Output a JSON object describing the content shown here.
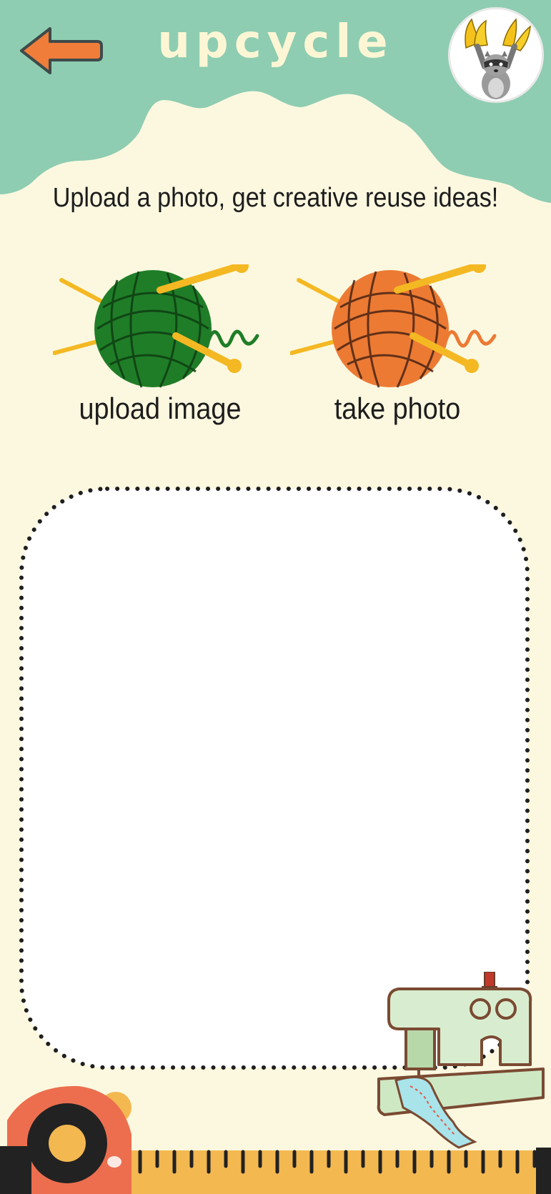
{
  "header": {
    "title": "upcycle",
    "back_icon": "arrow-left-icon",
    "avatar_icon": "raccoon-avatar-icon"
  },
  "subtitle": "Upload a photo, get creative reuse ideas!",
  "actions": [
    {
      "label": "upload image",
      "icon": "green-yarn-ball-icon"
    },
    {
      "label": "take photo",
      "icon": "orange-yarn-ball-icon"
    }
  ],
  "drop_zone": {
    "state": "empty"
  },
  "colors": {
    "header": "#8ECDB1",
    "background": "#FCF8E0",
    "title": "#FDF6D4",
    "back_arrow": "#F07D3A",
    "yarn_green": "#1F7D27",
    "yarn_orange": "#EC7A33",
    "needle": "#F4B823",
    "ruler": "#F4B850"
  }
}
